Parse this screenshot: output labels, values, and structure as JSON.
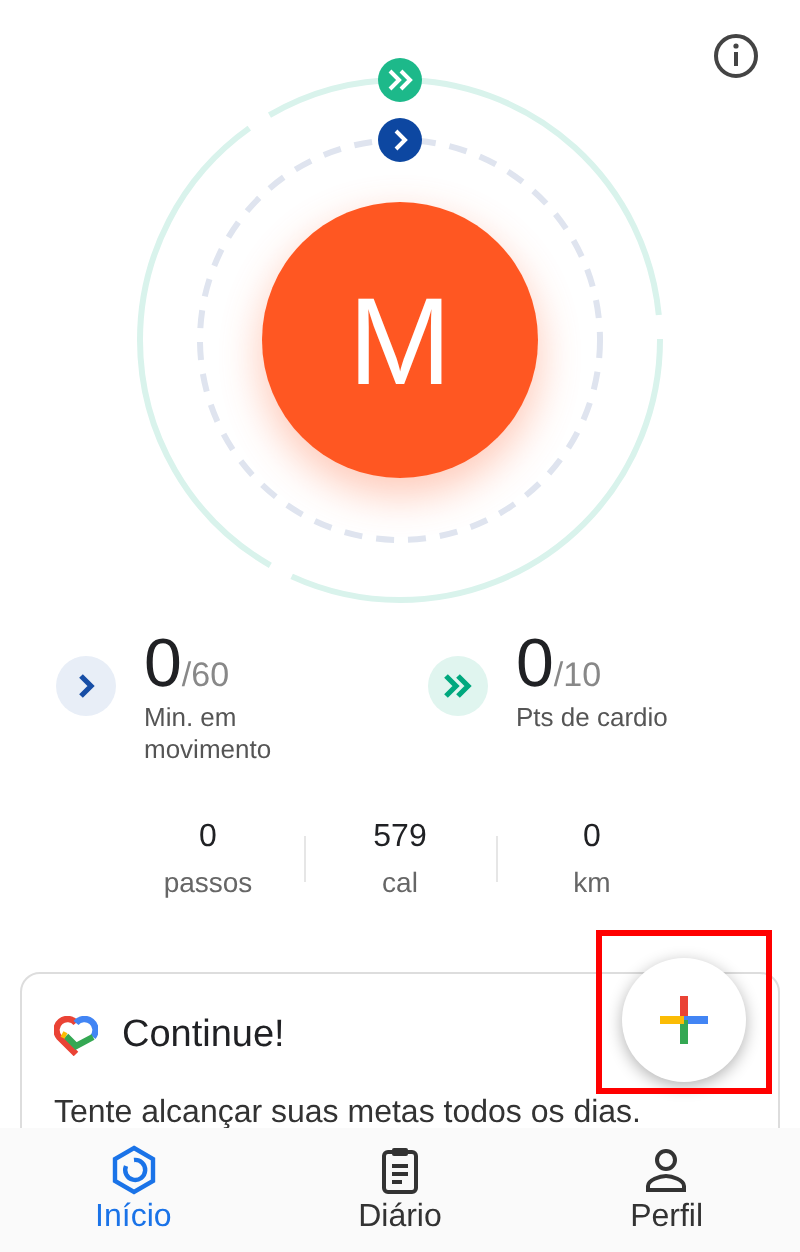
{
  "ring": {
    "letter": "M"
  },
  "goals": [
    {
      "kind": "move",
      "value": "0",
      "target": "/60",
      "label": "Min. em movimento"
    },
    {
      "kind": "cardio",
      "value": "0",
      "target": "/10",
      "label": "Pts de cardio"
    }
  ],
  "stats": [
    {
      "value": "0",
      "label": "passos"
    },
    {
      "value": "579",
      "label": "cal"
    },
    {
      "value": "0",
      "label": "km"
    }
  ],
  "card": {
    "title": "Continue!",
    "text": "Tente alcançar suas metas todos os dias."
  },
  "nav": [
    {
      "kind": "home",
      "label": "Início",
      "selected": true
    },
    {
      "kind": "journal",
      "label": "Diário",
      "selected": false
    },
    {
      "kind": "profile",
      "label": "Perfil",
      "selected": false
    }
  ]
}
